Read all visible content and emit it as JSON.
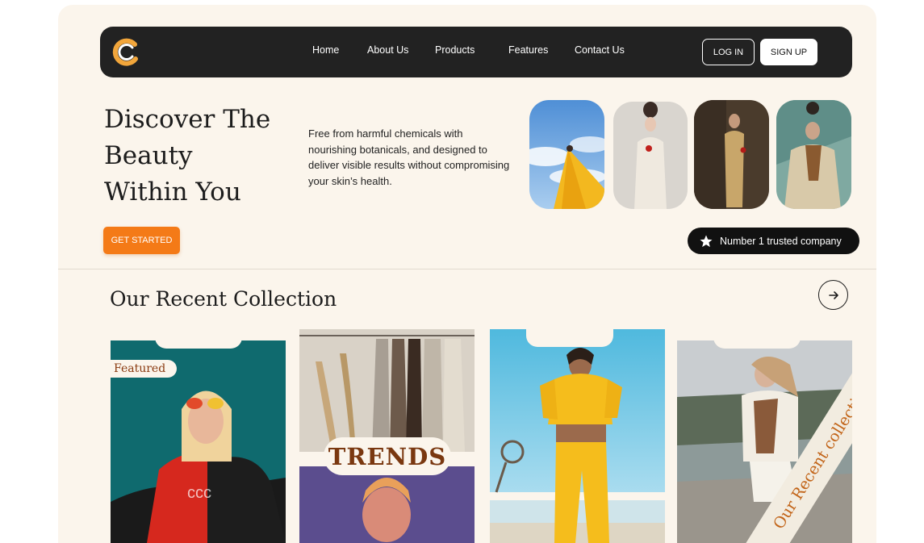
{
  "nav": {
    "links": [
      "Home",
      "About Us",
      "Products",
      "Features",
      "Contact Us"
    ],
    "login_label": "LOG IN",
    "signup_label": "SIGN UP"
  },
  "hero": {
    "title_lines": [
      "Discover The",
      "Beauty",
      "Within You"
    ],
    "description": "Free from harmful chemicals with nourishing botanicals, and designed to deliver visible results without compromising your skin’s health.",
    "cta_label": "GET STARTED",
    "badge_text": "Number 1 trusted company"
  },
  "collection": {
    "title": "Our Recent Collection",
    "featured_tag": "Featured",
    "trends_label": "TRENDS",
    "diagonal_label": "Our Recent collection"
  },
  "colors": {
    "accent": "#f47a17",
    "nav_bg": "#222222",
    "page_bg": "#fbf5ec"
  },
  "icons": [
    "logo-mark",
    "star-icon",
    "arrow-right-icon"
  ]
}
